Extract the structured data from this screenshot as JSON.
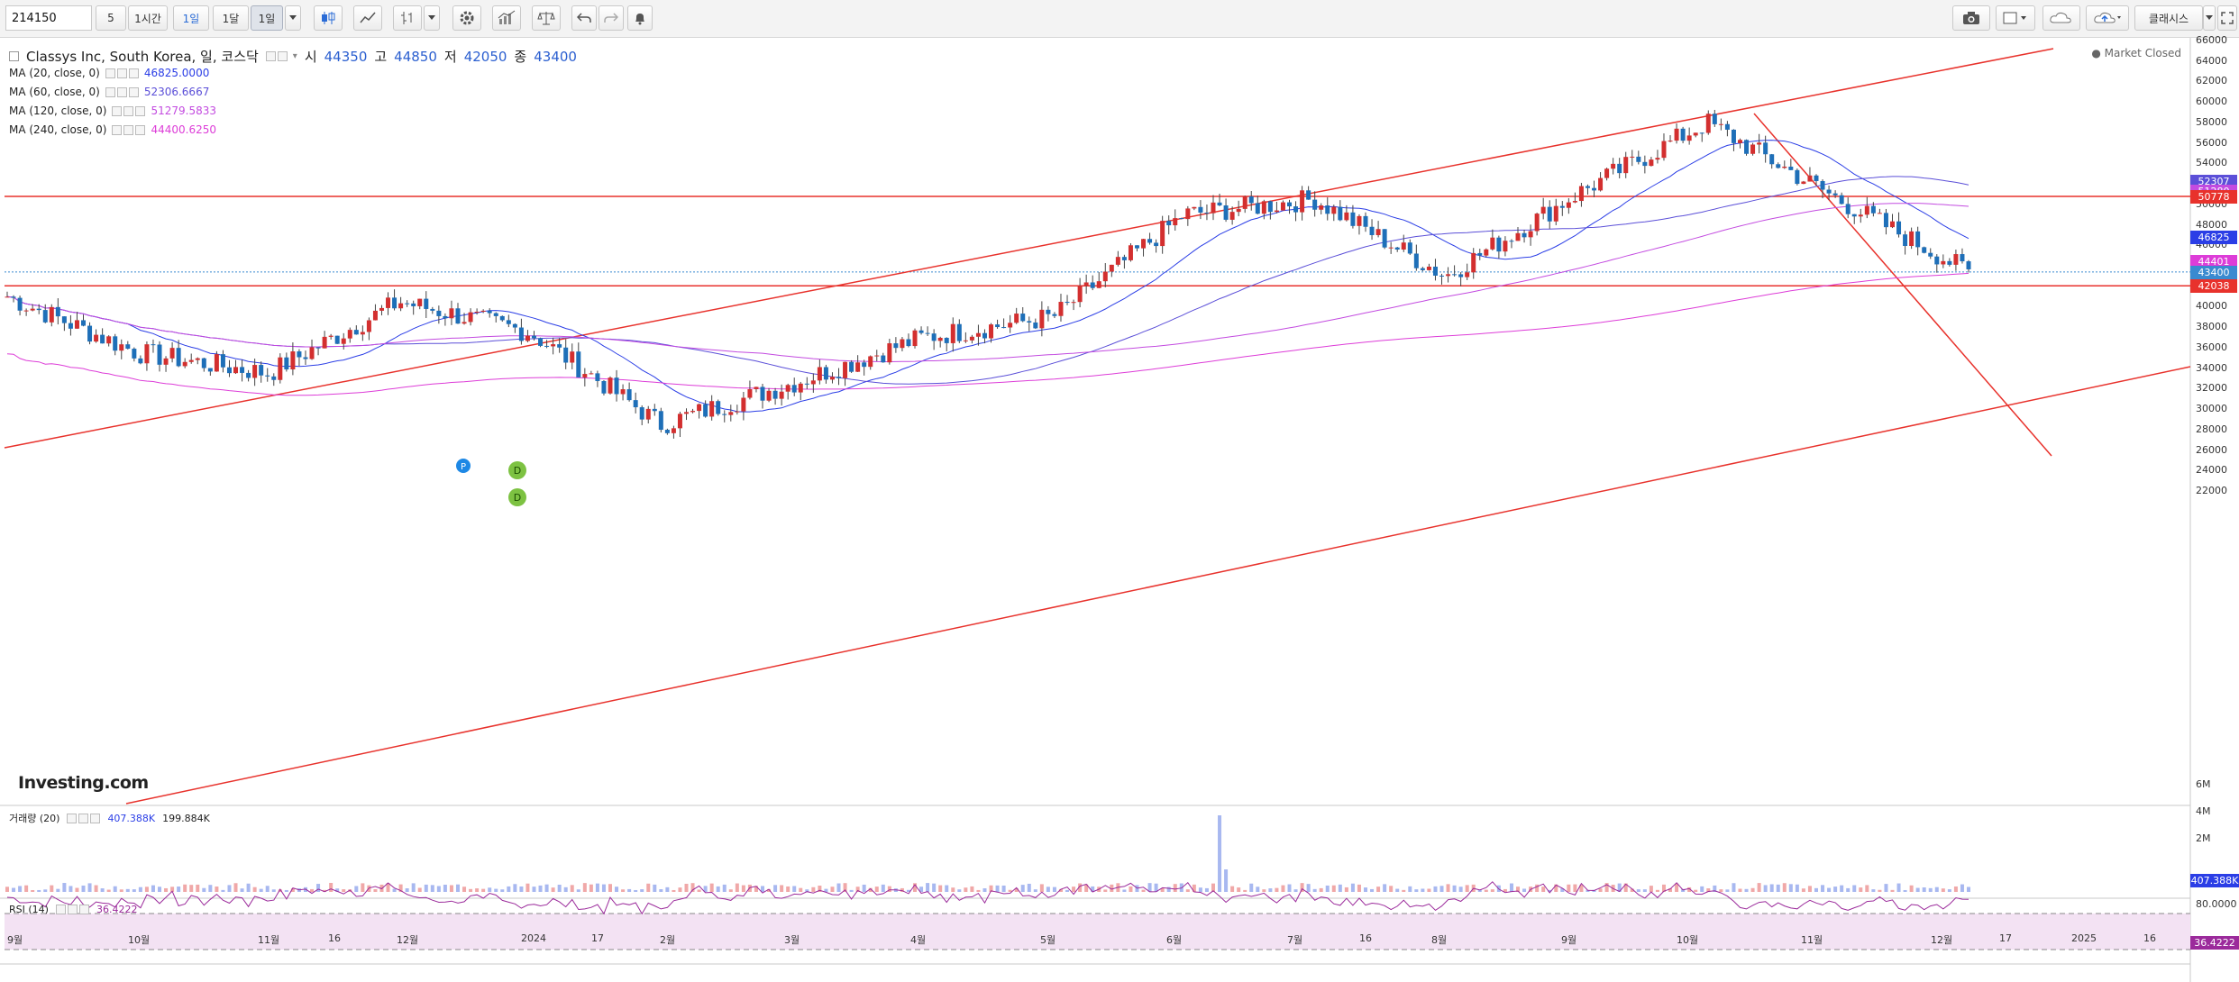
{
  "toolbar": {
    "symbol": "214150",
    "intervals": [
      "5",
      "1시간",
      "1일",
      "1달",
      "1일",
      "1일"
    ],
    "right_label": "클래시스",
    "accent": "#2b6cd6"
  },
  "header": {
    "title": "Classys Inc, South Korea, 일, 코스닥",
    "o_label": "시",
    "o": "44350",
    "h_label": "고",
    "h": "44850",
    "l_label": "저",
    "l": "42050",
    "c_label": "종",
    "c": "43400",
    "market_status": "Market Closed"
  },
  "ma_legend": [
    {
      "label": "MA (20, close, 0)",
      "value": "46825.0000",
      "color": "#2b3ee6"
    },
    {
      "label": "MA (60, close, 0)",
      "value": "52306.6667",
      "color": "#5b4fd8"
    },
    {
      "label": "MA (120, close, 0)",
      "value": "51279.5833",
      "color": "#c34be0"
    },
    {
      "label": "MA (240, close, 0)",
      "value": "44400.6250",
      "color": "#dd3dd8"
    }
  ],
  "volume_legend": {
    "label": "거래량 (20)",
    "v1": "407.388K",
    "v2": "199.884K"
  },
  "rsi_legend": {
    "label": "RSI (14)",
    "value": "36.4222"
  },
  "watermark": "Investing.com",
  "markers": [
    "P",
    "D",
    "D"
  ],
  "price_axis": [
    "66000",
    "64000",
    "62000",
    "60000",
    "58000",
    "56000",
    "54000",
    "52000",
    "50000",
    "48000",
    "46000",
    "44000",
    "42000",
    "40000",
    "38000",
    "36000",
    "34000",
    "32000",
    "30000",
    "28000",
    "26000",
    "24000",
    "22000"
  ],
  "price_tags": [
    {
      "text": "52307",
      "color": "#5b4fd8",
      "value": 52307
    },
    {
      "text": "51280",
      "color": "#c34be0",
      "value": 51280
    },
    {
      "text": "50778",
      "color": "#e8322c",
      "value": 50778
    },
    {
      "text": "46825",
      "color": "#2b3ee6",
      "value": 46825
    },
    {
      "text": "44401",
      "color": "#dd3dd8",
      "value": 44401
    },
    {
      "text": "43400",
      "color": "#3a8ad0",
      "value": 43400
    },
    {
      "text": "42038",
      "color": "#e8322c",
      "value": 42038
    }
  ],
  "volume_axis": [
    "6M",
    "4M",
    "2M"
  ],
  "volume_tag": "407.388K",
  "rsi_axis": [
    "80.0000"
  ],
  "rsi_tag": "36.4222",
  "date_axis": [
    "9월",
    "10월",
    "11월",
    "16",
    "12월",
    "2024",
    "17",
    "2월",
    "3월",
    "4월",
    "5월",
    "6월",
    "7월",
    "16",
    "8월",
    "9월",
    "10월",
    "11월",
    "12월",
    "17",
    "2025",
    "16"
  ],
  "chart_data": {
    "type": "candlestick",
    "title": "Classys Inc, South Korea, 일, 코스닥",
    "ylim": [
      21000,
      67000
    ],
    "horizontal_levels": [
      50778,
      42038
    ],
    "last_close": 43400,
    "series": [
      {
        "name": "MA (20, close, 0)",
        "last": 46825.0
      },
      {
        "name": "MA (60, close, 0)",
        "last": 52306.6667
      },
      {
        "name": "MA (120, close, 0)",
        "last": 51279.5833
      },
      {
        "name": "MA (240, close, 0)",
        "last": 44400.625
      }
    ],
    "price_path_monthly": [
      {
        "x": "9월",
        "close": 41000
      },
      {
        "x": "10월",
        "close": 35500
      },
      {
        "x": "11월",
        "close": 33500
      },
      {
        "x": "12월",
        "close": 40500
      },
      {
        "x": "2024",
        "close": 37500
      },
      {
        "x": "2월",
        "close": 28500
      },
      {
        "x": "3월",
        "close": 32500
      },
      {
        "x": "4월",
        "close": 37000
      },
      {
        "x": "5월",
        "close": 39000
      },
      {
        "x": "6월",
        "close": 49000
      },
      {
        "x": "7월",
        "close": 50500
      },
      {
        "x": "8월",
        "close": 43000
      },
      {
        "x": "9월",
        "close": 51000
      },
      {
        "x": "10월",
        "close": 58000
      },
      {
        "x": "11월",
        "close": 50500
      },
      {
        "x": "12월",
        "close": 43400
      }
    ]
  }
}
